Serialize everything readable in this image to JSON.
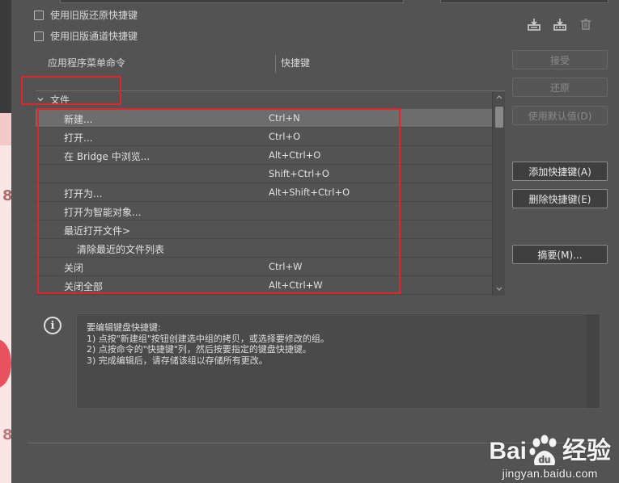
{
  "options": {
    "legacy_undo_label": "使用旧版还原快捷键",
    "legacy_channel_label": "使用旧版通道快捷键"
  },
  "toolbar_icons": [
    "save-set-icon",
    "save-as-set-icon",
    "delete-set-icon"
  ],
  "columns": {
    "command": "应用程序菜单命令",
    "shortcut": "快捷键"
  },
  "group": {
    "label": "文件",
    "expanded": true
  },
  "rows": [
    {
      "command": "新建...",
      "shortcut": "Ctrl+N",
      "indent": false,
      "selected": true
    },
    {
      "command": "打开...",
      "shortcut": "Ctrl+O",
      "indent": false,
      "selected": false
    },
    {
      "command": "在 Bridge 中浏览...",
      "shortcut": "Alt+Ctrl+O",
      "indent": false,
      "selected": false
    },
    {
      "command": "",
      "shortcut": "Shift+Ctrl+O",
      "indent": false,
      "selected": false
    },
    {
      "command": "打开为...",
      "shortcut": "Alt+Shift+Ctrl+O",
      "indent": false,
      "selected": false
    },
    {
      "command": "打开为智能对象...",
      "shortcut": "",
      "indent": false,
      "selected": false
    },
    {
      "command": "最近打开文件>",
      "shortcut": "",
      "indent": false,
      "selected": false
    },
    {
      "command": "清除最近的文件列表",
      "shortcut": "",
      "indent": true,
      "selected": false
    },
    {
      "command": "关闭",
      "shortcut": "Ctrl+W",
      "indent": false,
      "selected": false
    },
    {
      "command": "关闭全部",
      "shortcut": "Alt+Ctrl+W",
      "indent": false,
      "selected": false
    }
  ],
  "buttons": {
    "accept": "接受",
    "undo": "还原",
    "use_default": "使用默认值(D)",
    "add_shortcut": "添加快捷键(A)",
    "delete_shortcut": "删除快捷键(E)",
    "summarize": "摘要(M)..."
  },
  "info": {
    "heading": "要编辑键盘快捷键:",
    "lines": [
      "1) 点按\"新建组\"按钮创建选中组的拷贝，或选择要修改的组。",
      "2) 点按命令的\"快捷键\"列，然后按要指定的键盘快捷键。",
      "3) 完成编辑后，请存储该组以存储所有更改。"
    ]
  },
  "watermark": {
    "logo": "Bai du 经验",
    "logo_left": "Bai",
    "logo_right": "经验",
    "url": "jingyan.baidu.com"
  },
  "colors": {
    "panel_bg": "#535353",
    "selected_row": "#6d6d6d",
    "annotation_red": "#e0262c"
  }
}
